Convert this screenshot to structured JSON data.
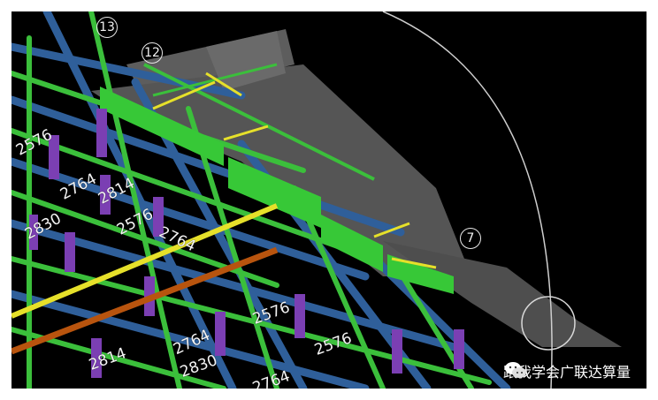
{
  "axis_labels": [
    "13",
    "12",
    "7"
  ],
  "dimension_labels": [
    "2576",
    "2764",
    "2814",
    "2830",
    "2576",
    "2764",
    "2576",
    "2764",
    "2814",
    "2830",
    "2576",
    "2764"
  ],
  "watermark_text": "跟我学会广联达算量",
  "colors": {
    "background": "#000000",
    "beam_green": "#3bbf3b",
    "beam_blue": "#2f5f9a",
    "column_purple": "#7b3fb3",
    "gray_slab": "#5a5a5a",
    "yellow_rebar": "#e6e02a",
    "orange_rebar": "#b8540e",
    "arc": "#cfcfcf"
  }
}
